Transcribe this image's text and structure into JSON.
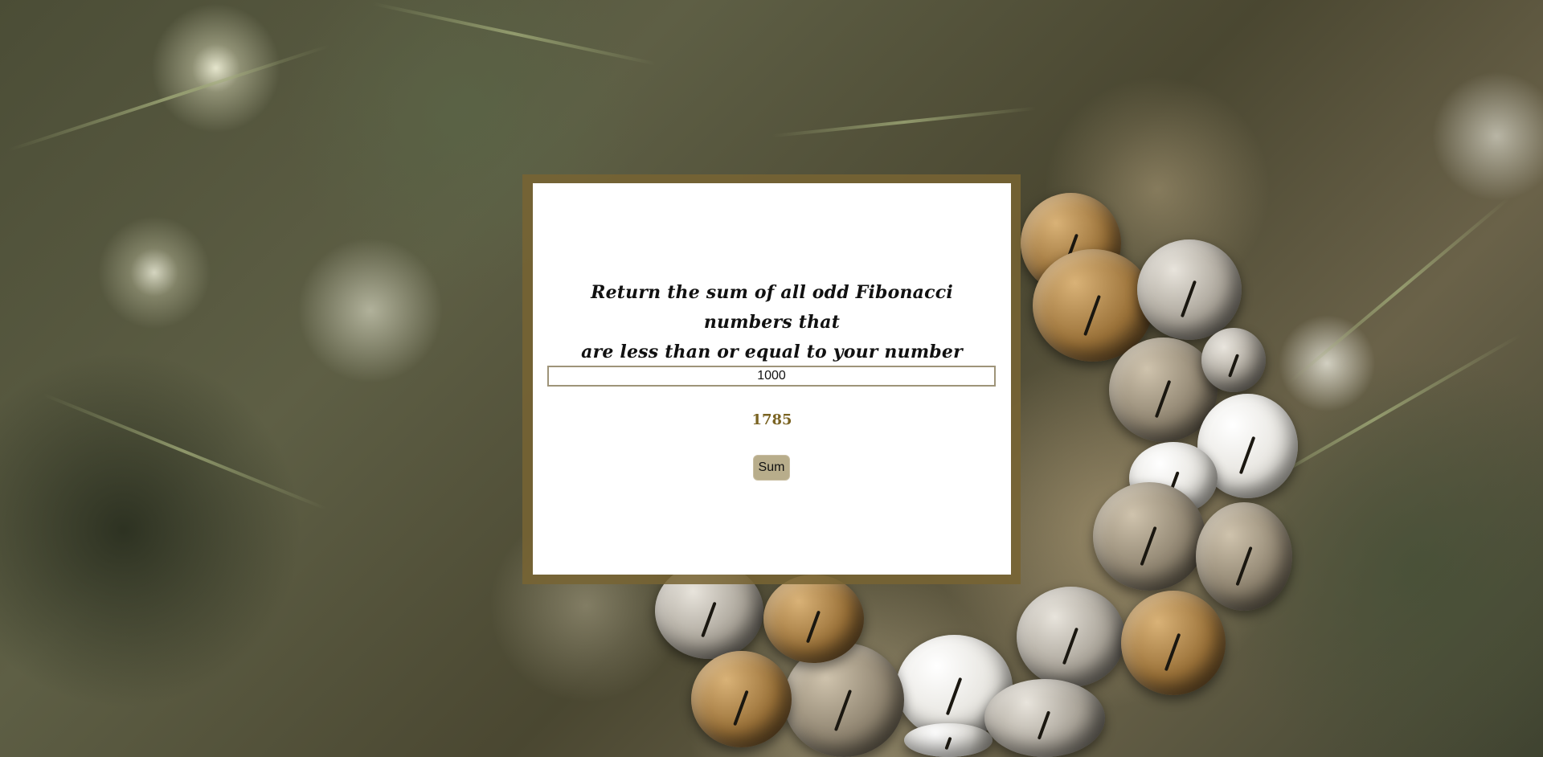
{
  "prompt": {
    "line1": "Return the sum of all odd Fibonacci numbers that",
    "line2": "are less than or equal to your number"
  },
  "input": {
    "value": "1000"
  },
  "result": "1785",
  "button": {
    "label": "Sum"
  },
  "colors": {
    "frame": "#786432",
    "card": "#ffffff",
    "result_text": "#7a6322",
    "button_bg": "#b8ad8b"
  }
}
